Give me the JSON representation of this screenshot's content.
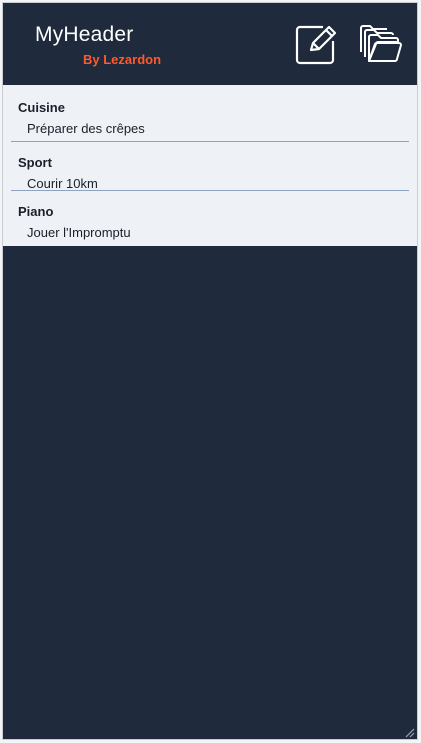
{
  "header": {
    "title": "MyHeader",
    "subtitle": "By Lezardon",
    "subtitle_color": "#ff5a2c",
    "background_color": "#1f2a3c",
    "actions": [
      {
        "icon": "edit-icon"
      },
      {
        "icon": "folder-icon"
      }
    ]
  },
  "list": {
    "background_color": "#eef1f6",
    "items": [
      {
        "title": "Cuisine",
        "description": "Préparer des crêpes"
      },
      {
        "title": "Sport",
        "description": "Courir 10km"
      },
      {
        "title": "Piano",
        "description": "Jouer l'Impromptu"
      }
    ]
  }
}
